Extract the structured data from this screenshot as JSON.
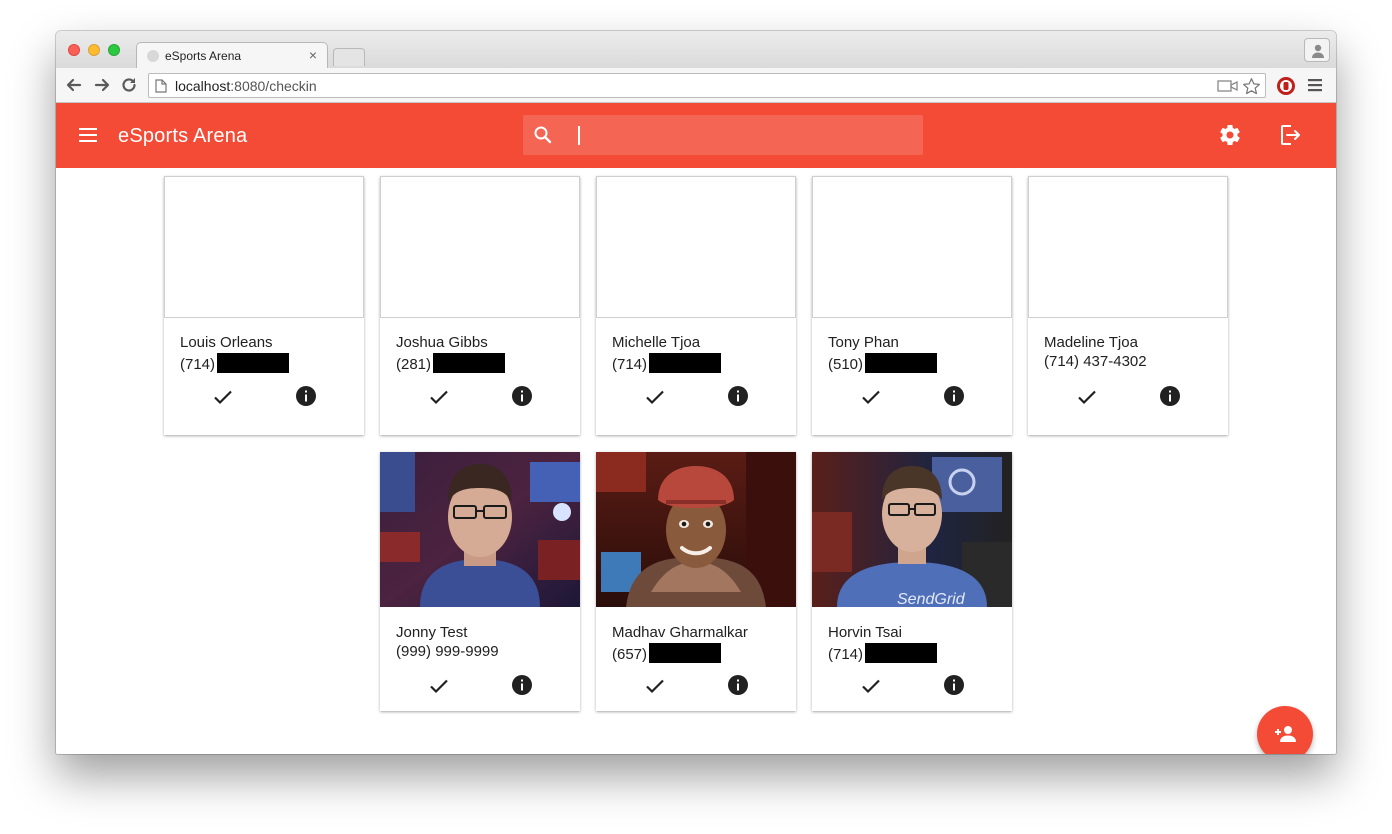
{
  "browser": {
    "tab_title": "eSports Arena",
    "tab_close": "×",
    "url_host": "localhost",
    "url_path": ":8080/checkin"
  },
  "app": {
    "title": "eSports Arena",
    "search_placeholder": "",
    "search_value": "",
    "accent_color": "#f44b36"
  },
  "cards_row1": [
    {
      "name": "Louis Orleans",
      "phone_prefix": "(714)",
      "phone_rest": "",
      "redacted": true
    },
    {
      "name": "Joshua Gibbs",
      "phone_prefix": "(281)",
      "phone_rest": "",
      "redacted": true
    },
    {
      "name": "Michelle Tjoa",
      "phone_prefix": "(714)",
      "phone_rest": "",
      "redacted": true
    },
    {
      "name": "Tony Phan",
      "phone_prefix": "(510)",
      "phone_rest": "",
      "redacted": true
    },
    {
      "name": "Madeline Tjoa",
      "phone_prefix": "(714)",
      "phone_rest": "437-4302",
      "redacted": false
    }
  ],
  "cards_row2": [
    {
      "name": "Jonny Test",
      "phone_prefix": "(999)",
      "phone_rest": "999-9999",
      "redacted": false,
      "photo": "young man with glasses, blue shirt"
    },
    {
      "name": "Madhav Gharmalkar",
      "phone_prefix": "(657)",
      "phone_rest": "",
      "redacted": true,
      "photo": "smiling man with red cap and scarf"
    },
    {
      "name": "Horvin Tsai",
      "phone_prefix": "(714)",
      "phone_rest": "",
      "redacted": true,
      "photo": "young man with glasses, SendGrid shirt"
    }
  ],
  "photo_shirt_text": "SendGrid",
  "icons": {
    "check": "check-icon",
    "info": "info-icon",
    "menu": "menu-icon",
    "search": "search-icon",
    "settings": "gear-icon",
    "logout": "logout-icon",
    "fab": "add-person-icon"
  }
}
